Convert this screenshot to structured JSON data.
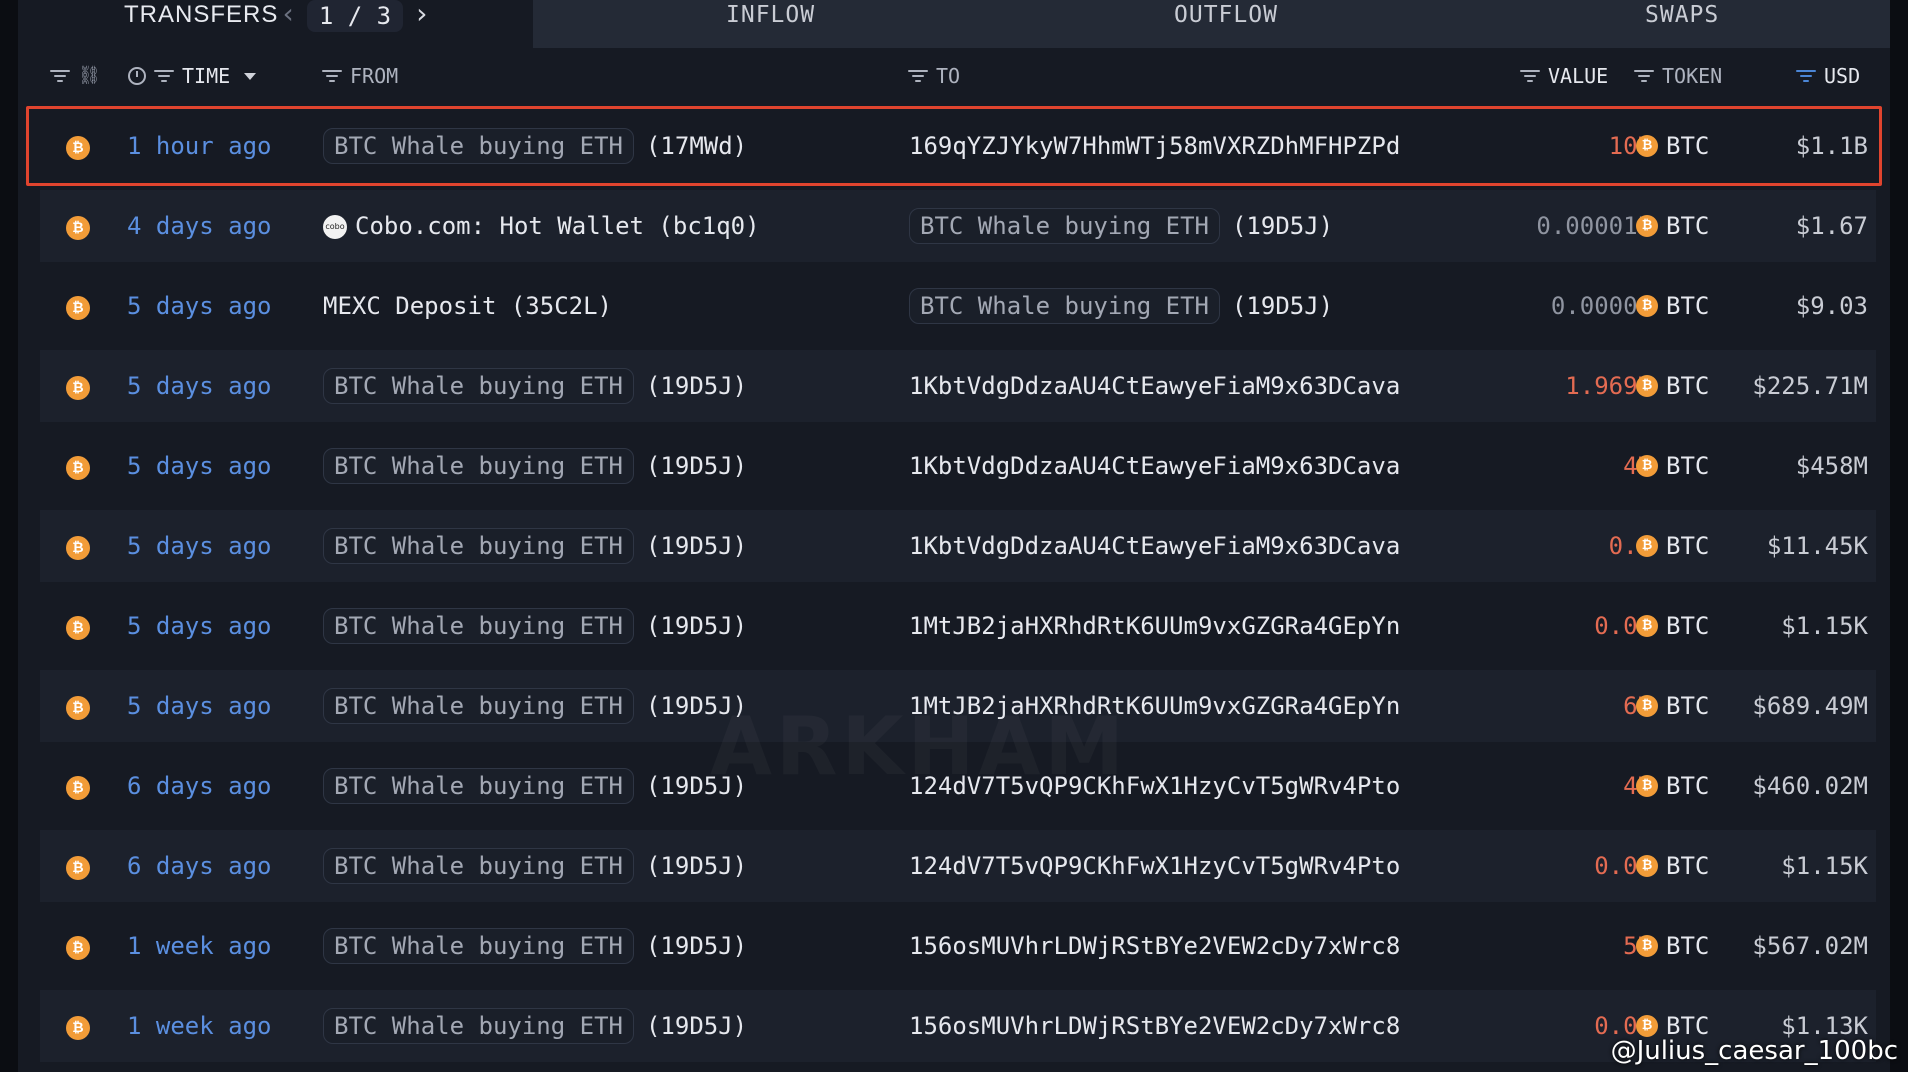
{
  "tabs": {
    "transfers": "TRANSFERS",
    "inflow": "INFLOW",
    "outflow": "OUTFLOW",
    "swaps": "SWAPS"
  },
  "pager": {
    "prev": "‹",
    "current": "1 / 3",
    "next": "›"
  },
  "columns": {
    "time": "TIME",
    "from": "FROM",
    "to": "TO",
    "value": "VALUE",
    "token": "TOKEN",
    "usd": "USD"
  },
  "colors": {
    "accent_blue": "#5b8fe0",
    "value_red": "#e36b52",
    "btc_orange": "#f29c38",
    "highlight_red": "#e0442e"
  },
  "icons": {
    "token_icon": "bitcoin-icon",
    "filter_icon": "filter-icon",
    "clock_icon": "clock-icon",
    "link_icon": "link-icon"
  },
  "rows": [
    {
      "time": "1 hour ago",
      "from_entity": "BTC Whale buying ETH",
      "from_short": "(17MWd)",
      "from_plain": "",
      "to_entity": "",
      "to_short": "",
      "to_addr": "169qYZJYkyW7HhmWTj58mVXRZDhMFHPZPd",
      "value": "10K",
      "value_style": "red",
      "token": "BTC",
      "usd": "$1.1B"
    },
    {
      "time": "4 days ago",
      "from_entity": "",
      "from_short": "",
      "from_plain": "Cobo.com: Hot Wallet (bc1q0)",
      "to_entity": "BTC Whale buying ETH",
      "to_short": "(19D5J)",
      "to_addr": "",
      "value": "0.000015",
      "value_style": "grey",
      "token": "BTC",
      "usd": "$1.67"
    },
    {
      "time": "5 days ago",
      "from_entity": "",
      "from_short": "",
      "from_plain": "MEXC Deposit (35C2L)",
      "to_entity": "BTC Whale buying ETH",
      "to_short": "(19D5J)",
      "to_addr": "",
      "value": "0.00008",
      "value_style": "grey",
      "token": "BTC",
      "usd": "$9.03"
    },
    {
      "time": "5 days ago",
      "from_entity": "BTC Whale buying ETH",
      "from_short": "(19D5J)",
      "from_plain": "",
      "to_entity": "",
      "to_short": "",
      "to_addr": "1KbtVdgDdzaAU4CtEawyeFiaM9x63DCava",
      "value": "1.969K",
      "value_style": "red",
      "token": "BTC",
      "usd": "$225.71M"
    },
    {
      "time": "5 days ago",
      "from_entity": "BTC Whale buying ETH",
      "from_short": "(19D5J)",
      "from_plain": "",
      "to_entity": "",
      "to_short": "",
      "to_addr": "1KbtVdgDdzaAU4CtEawyeFiaM9x63DCava",
      "value": "4K",
      "value_style": "red",
      "token": "BTC",
      "usd": "$458M"
    },
    {
      "time": "5 days ago",
      "from_entity": "BTC Whale buying ETH",
      "from_short": "(19D5J)",
      "from_plain": "",
      "to_entity": "",
      "to_short": "",
      "to_addr": "1KbtVdgDdzaAU4CtEawyeFiaM9x63DCava",
      "value": "0.1",
      "value_style": "red",
      "token": "BTC",
      "usd": "$11.45K"
    },
    {
      "time": "5 days ago",
      "from_entity": "BTC Whale buying ETH",
      "from_short": "(19D5J)",
      "from_plain": "",
      "to_entity": "",
      "to_short": "",
      "to_addr": "1MtJB2jaHXRhdRtK6UUm9vxGZGRa4GEpYn",
      "value": "0.01",
      "value_style": "red",
      "token": "BTC",
      "usd": "$1.15K"
    },
    {
      "time": "5 days ago",
      "from_entity": "BTC Whale buying ETH",
      "from_short": "(19D5J)",
      "from_plain": "",
      "to_entity": "",
      "to_short": "",
      "to_addr": "1MtJB2jaHXRhdRtK6UUm9vxGZGRa4GEpYn",
      "value": "6K",
      "value_style": "red",
      "token": "BTC",
      "usd": "$689.49M"
    },
    {
      "time": "6 days ago",
      "from_entity": "BTC Whale buying ETH",
      "from_short": "(19D5J)",
      "from_plain": "",
      "to_entity": "",
      "to_short": "",
      "to_addr": "124dV7T5vQP9CKhFwX1HzyCvT5gWRv4Pto",
      "value": "4K",
      "value_style": "red",
      "token": "BTC",
      "usd": "$460.02M"
    },
    {
      "time": "6 days ago",
      "from_entity": "BTC Whale buying ETH",
      "from_short": "(19D5J)",
      "from_plain": "",
      "to_entity": "",
      "to_short": "",
      "to_addr": "124dV7T5vQP9CKhFwX1HzyCvT5gWRv4Pto",
      "value": "0.01",
      "value_style": "red",
      "token": "BTC",
      "usd": "$1.15K"
    },
    {
      "time": "1 week ago",
      "from_entity": "BTC Whale buying ETH",
      "from_short": "(19D5J)",
      "from_plain": "",
      "to_entity": "",
      "to_short": "",
      "to_addr": "156osMUVhrLDWjRStBYe2VEW2cDy7xWrc8",
      "value": "5K",
      "value_style": "red",
      "token": "BTC",
      "usd": "$567.02M"
    },
    {
      "time": "1 week ago",
      "from_entity": "BTC Whale buying ETH",
      "from_short": "(19D5J)",
      "from_plain": "",
      "to_entity": "",
      "to_short": "",
      "to_addr": "156osMUVhrLDWjRStBYe2VEW2cDy7xWrc8",
      "value": "0.01",
      "value_style": "red",
      "token": "BTC",
      "usd": "$1.13K"
    }
  ],
  "watermark": "ARKHAM",
  "credit": "@Julius_caesar_100bc"
}
